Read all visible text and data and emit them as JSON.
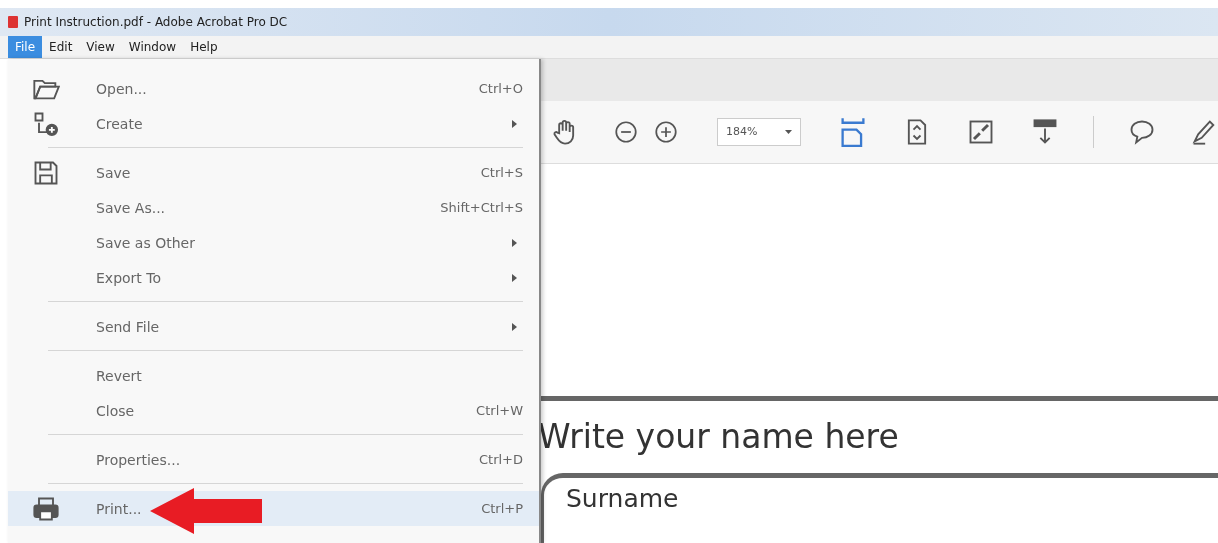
{
  "window": {
    "title": "Print Instruction.pdf - Adobe Acrobat Pro DC"
  },
  "menu_bar": [
    {
      "label": "File",
      "selected": true
    },
    {
      "label": "Edit",
      "selected": false
    },
    {
      "label": "View",
      "selected": false
    },
    {
      "label": "Window",
      "selected": false
    },
    {
      "label": "Help",
      "selected": false
    }
  ],
  "file_menu": [
    {
      "kind": "item",
      "label": "Open...",
      "shortcut": "Ctrl+O",
      "selected": false
    },
    {
      "kind": "item",
      "label": "Create",
      "submenu": true,
      "selected": false
    },
    {
      "kind": "separator"
    },
    {
      "kind": "item",
      "label": "Save",
      "shortcut": "Ctrl+S",
      "selected": false
    },
    {
      "kind": "item",
      "label": "Save As...",
      "shortcut": "Shift+Ctrl+S",
      "selected": false
    },
    {
      "kind": "item",
      "label": "Save as Other",
      "submenu": true,
      "selected": false
    },
    {
      "kind": "item",
      "label": "Export To",
      "submenu": true,
      "selected": false
    },
    {
      "kind": "separator"
    },
    {
      "kind": "item",
      "label": "Send File",
      "submenu": true,
      "selected": false
    },
    {
      "kind": "separator"
    },
    {
      "kind": "item",
      "label": "Revert",
      "selected": false
    },
    {
      "kind": "item",
      "label": "Close",
      "shortcut": "Ctrl+W",
      "selected": false
    },
    {
      "kind": "separator"
    },
    {
      "kind": "item",
      "label": "Properties...",
      "shortcut": "Ctrl+D",
      "selected": false
    },
    {
      "kind": "separator"
    },
    {
      "kind": "item",
      "label": "Print...",
      "shortcut": "Ctrl+P",
      "selected": true
    }
  ],
  "toolbar": {
    "zoom": "184%"
  },
  "document": {
    "heading": "Write your name here",
    "field_label": "Surname"
  }
}
